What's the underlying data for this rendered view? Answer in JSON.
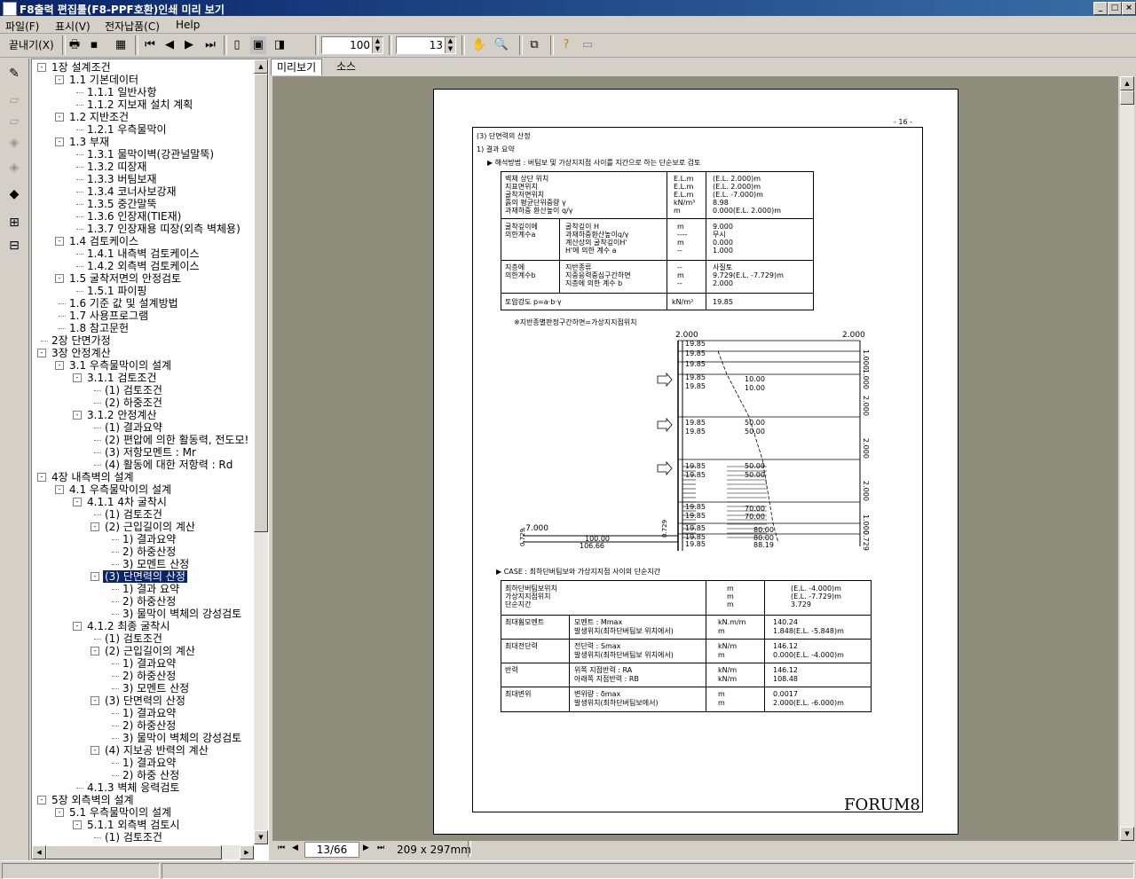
{
  "window": {
    "title": "F8출력 편집툴(F8-PPF호환)인쇄 미리 보기"
  },
  "menu": {
    "file": "파일(F)",
    "view": "표시(V)",
    "submit": "전자납품(C)",
    "help": "Help"
  },
  "toolbar": {
    "close_label": "끝내기(X)",
    "zoom_value": "100",
    "page_value": "13"
  },
  "tabs": {
    "preview": "미리보기",
    "source": "소스"
  },
  "tree": [
    {
      "label": "1장 설계조건",
      "level": 0,
      "exp": "-"
    },
    {
      "label": "1.1 기본데이터",
      "level": 1,
      "exp": "-"
    },
    {
      "label": "1.1.1 일반사항",
      "level": 2,
      "exp": ""
    },
    {
      "label": "1.1.2 지보재 설치 계획",
      "level": 2,
      "exp": ""
    },
    {
      "label": "1.2 지반조건",
      "level": 1,
      "exp": "-"
    },
    {
      "label": "1.2.1 우측물막이",
      "level": 2,
      "exp": ""
    },
    {
      "label": "1.3 부재",
      "level": 1,
      "exp": "-"
    },
    {
      "label": "1.3.1 물막이벽(강관널말뚝)",
      "level": 2,
      "exp": ""
    },
    {
      "label": "1.3.2 띠장재",
      "level": 2,
      "exp": ""
    },
    {
      "label": "1.3.3 버팀보재",
      "level": 2,
      "exp": ""
    },
    {
      "label": "1.3.4 코너사보강재",
      "level": 2,
      "exp": ""
    },
    {
      "label": "1.3.5 중간말뚝",
      "level": 2,
      "exp": ""
    },
    {
      "label": "1.3.6 인장재(TIE재)",
      "level": 2,
      "exp": ""
    },
    {
      "label": "1.3.7 인장재용 띠장(외측 벽체용)",
      "level": 2,
      "exp": ""
    },
    {
      "label": "1.4 검토케이스",
      "level": 1,
      "exp": "-"
    },
    {
      "label": "1.4.1 내측벽 검토케이스",
      "level": 2,
      "exp": ""
    },
    {
      "label": "1.4.2 외측벽 검토케이스",
      "level": 2,
      "exp": ""
    },
    {
      "label": "1.5 굴착저면의 안정검토",
      "level": 1,
      "exp": "-"
    },
    {
      "label": "1.5.1 파이핑",
      "level": 2,
      "exp": ""
    },
    {
      "label": "1.6 기준 값 및 설계방법",
      "level": 1,
      "exp": ""
    },
    {
      "label": "1.7 사용프로그램",
      "level": 1,
      "exp": ""
    },
    {
      "label": "1.8 참고문헌",
      "level": 1,
      "exp": ""
    },
    {
      "label": "2장 단면가정",
      "level": 0,
      "exp": ""
    },
    {
      "label": "3장 안정계산",
      "level": 0,
      "exp": "-"
    },
    {
      "label": "3.1 우측물막이의 설계",
      "level": 1,
      "exp": "-"
    },
    {
      "label": "3.1.1 검토조건",
      "level": 2,
      "exp": "-"
    },
    {
      "label": "(1) 검토조건",
      "level": 3,
      "exp": ""
    },
    {
      "label": "(2) 하중조건",
      "level": 3,
      "exp": ""
    },
    {
      "label": "3.1.2 안정계산",
      "level": 2,
      "exp": "-"
    },
    {
      "label": "(1) 결과요약",
      "level": 3,
      "exp": ""
    },
    {
      "label": "(2) 편압에 의한 활동력, 전도모!",
      "level": 3,
      "exp": ""
    },
    {
      "label": "(3) 저항모멘트 : Mr",
      "level": 3,
      "exp": ""
    },
    {
      "label": "(4) 활동에 대한 저항력 : Rd",
      "level": 3,
      "exp": ""
    },
    {
      "label": "4장 내측벽의 설계",
      "level": 0,
      "exp": "-"
    },
    {
      "label": "4.1 우측물막이의 설계",
      "level": 1,
      "exp": "-"
    },
    {
      "label": "4.1.1 4차 굴착시",
      "level": 2,
      "exp": "-"
    },
    {
      "label": "(1) 검토조건",
      "level": 3,
      "exp": ""
    },
    {
      "label": "(2) 근입길이의 계산",
      "level": 3,
      "exp": "-"
    },
    {
      "label": "1) 결과요약",
      "level": 4,
      "exp": ""
    },
    {
      "label": "2) 하중산정",
      "level": 4,
      "exp": ""
    },
    {
      "label": "3) 모멘트 산정",
      "level": 4,
      "exp": ""
    },
    {
      "label": "(3) 단면력의 산정",
      "level": 3,
      "exp": "-",
      "selected": true
    },
    {
      "label": "1) 결과 요약",
      "level": 4,
      "exp": ""
    },
    {
      "label": "2) 하중산정",
      "level": 4,
      "exp": ""
    },
    {
      "label": "3) 물막이 벽체의 강성검토",
      "level": 4,
      "exp": ""
    },
    {
      "label": "4.1.2 최종 굴착시",
      "level": 2,
      "exp": "-"
    },
    {
      "label": "(1) 검토조건",
      "level": 3,
      "exp": ""
    },
    {
      "label": "(2) 근입길이의 계산",
      "level": 3,
      "exp": "-"
    },
    {
      "label": "1) 결과요약",
      "level": 4,
      "exp": ""
    },
    {
      "label": "2) 하중산정",
      "level": 4,
      "exp": ""
    },
    {
      "label": "3) 모멘트 산정",
      "level": 4,
      "exp": ""
    },
    {
      "label": "(3) 단면력의 산정",
      "level": 3,
      "exp": "-"
    },
    {
      "label": "1) 결과요약",
      "level": 4,
      "exp": ""
    },
    {
      "label": "2) 하중산정",
      "level": 4,
      "exp": ""
    },
    {
      "label": "3) 물막이 벽체의 강성검토",
      "level": 4,
      "exp": ""
    },
    {
      "label": "(4) 지보공 반력의 계산",
      "level": 3,
      "exp": "-"
    },
    {
      "label": "1) 결과요약",
      "level": 4,
      "exp": ""
    },
    {
      "label": "2) 하중 산정",
      "level": 4,
      "exp": ""
    },
    {
      "label": "4.1.3 벽체 응력검토",
      "level": 2,
      "exp": ""
    },
    {
      "label": "5장 외측벽의 설계",
      "level": 0,
      "exp": "-"
    },
    {
      "label": "5.1 우측물막이의 설계",
      "level": 1,
      "exp": "-"
    },
    {
      "label": "5.1.1 외측벽 검토시",
      "level": 2,
      "exp": "-"
    },
    {
      "label": "(1) 검토조건",
      "level": 3,
      "exp": ""
    }
  ],
  "document": {
    "page_no": "- 16 -",
    "heading": "(3) 단면력의 산정",
    "sub1": "1) 결과 요약",
    "bullet1": "▶ 해석방법 : 버팀보 및 가상지지점 사이를 지간으로 하는 단순보로 검토",
    "t1": {
      "r1_labels": [
        "벽체 상단 위치",
        "지표면위치",
        "굴착저면위치",
        "흙의 평균단위중량 γ",
        "과재하중 환산높이 q/γ"
      ],
      "r1_units": [
        "E.L.m",
        "E.L.m",
        "E.L.m",
        "kN/m³",
        "m"
      ],
      "r1_vals": [
        "(E.L.  2.000)m",
        "(E.L.  2.000)m",
        "(E.L. -7.000)m",
        "8.98",
        "0.000(E.L.  2.000)m"
      ],
      "r2_group": [
        "굴착깊이에",
        "의한계수a"
      ],
      "r2_labels": [
        "굴착깊이    H",
        "과재하중환산높이q/γ",
        "계산상의 굴착깊이H'",
        "H'에 의한 계수 a"
      ],
      "r2_units": [
        "m",
        "----",
        "m",
        "--"
      ],
      "r2_vals": [
        "9.000",
        "무시",
        "0.000",
        "1.000"
      ],
      "r3_group": [
        "지층에",
        "의한계수b"
      ],
      "r3_labels": [
        "지반종류",
        "지중응력중심구간하면",
        "지층에 의한 계수 b"
      ],
      "r3_units": [
        "--",
        "m",
        "--"
      ],
      "r3_vals": [
        "사질토",
        "9.729(E.L. -7.729)m",
        "2.000"
      ],
      "r4_label": "토압강도 p=a·b·γ",
      "r4_unit": "kN/m²",
      "r4_val": "19.85"
    },
    "note": "※지반종별판정구간하면=가상지지점위치",
    "diagram": {
      "top_left": "2.000",
      "top_right": "2.000",
      "left_vals": [
        "19.85",
        "19.85",
        "19.85",
        "19.85",
        "19.85",
        "19.85",
        "19.85",
        "19.85",
        "19.85",
        "19.85",
        "19.85",
        "19.85",
        "19.85",
        "19.85"
      ],
      "right_vals": [
        "10.00",
        "10.00",
        "50.00",
        "50.00",
        "50.00",
        "50.00",
        "70.00",
        "70.00",
        "80.00",
        "80.00",
        "88.19"
      ],
      "dims": [
        "1.000",
        "1.000",
        "2.000",
        "2.000",
        "2.000",
        "1.000",
        "0.729",
        "0.729",
        "0.729"
      ],
      "bottom_left": "-7.000",
      "bottom_vals": [
        "100.00",
        "106.66"
      ]
    },
    "case_line": "▶ CASE : 최하단버팀보와 가상지지점 사이의 단순지간",
    "t2": {
      "r0_labels": [
        "최하단버팀보위치",
        "가상지지점위치",
        "단순지간"
      ],
      "r0_units": [
        "m",
        "m",
        "m"
      ],
      "r0_vals": [
        "(E.L. -4.000)m",
        "(E.L. -7.729)m",
        "3.729"
      ],
      "rows": [
        {
          "name": "최대휨모멘트",
          "labels": [
            "모멘트 : Mmax",
            "발생위치(최하단버팀보 위치에서)"
          ],
          "units": [
            "kN.m/m",
            "m"
          ],
          "vals": [
            "140.24",
            "1.848(E.L. -5.848)m"
          ]
        },
        {
          "name": "최대전단력",
          "labels": [
            "전단력 : Smax",
            "발생위치(최하단버팀보 위치에서)"
          ],
          "units": [
            "kN/m",
            "m"
          ],
          "vals": [
            "146.12",
            "0.000(E.L. -4.000)m"
          ]
        },
        {
          "name": "반력",
          "labels": [
            "위쪽 지점반력 : RA",
            "아래쪽 지점반력 : RB"
          ],
          "units": [
            "kN/m",
            "kN/m"
          ],
          "vals": [
            "146.12",
            "108.48"
          ]
        },
        {
          "name": "최대변위",
          "labels": [
            "변위량 : δmax",
            "발생위치(최하단버팀보에서)"
          ],
          "units": [
            "m",
            "m"
          ],
          "vals": [
            "0.0017",
            "2.000(E.L. -6.000)m"
          ]
        }
      ]
    },
    "logo": "FORUM8"
  },
  "nav": {
    "page": "13/66",
    "size": "209 x 297mm"
  }
}
